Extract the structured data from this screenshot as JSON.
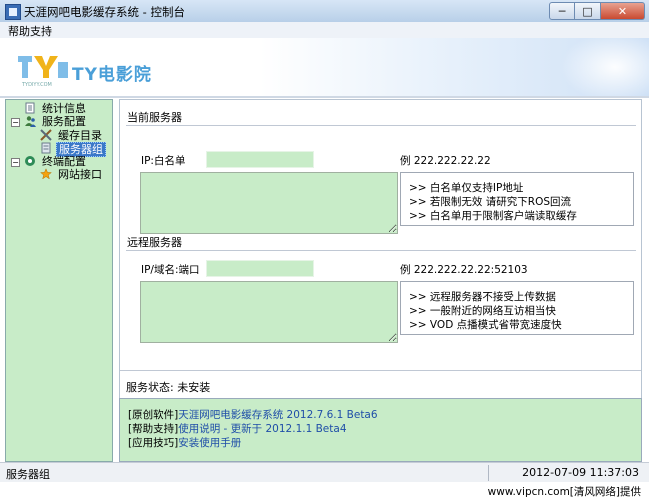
{
  "window": {
    "title": "天涯网吧电影缓存系统 - 控制台",
    "min_glyph": "─",
    "max_glyph": "□",
    "close_glyph": "✕"
  },
  "menu": {
    "help": "帮助支持"
  },
  "banner": {
    "logo_text": "TY电影院",
    "logo_sub": "TYDIYY.COM"
  },
  "tree": {
    "items": [
      {
        "label": "统计信息"
      },
      {
        "label": "服务配置",
        "expander": "−"
      },
      {
        "label": "缓存目录"
      },
      {
        "label": "服务器组"
      },
      {
        "label": "终端配置",
        "expander": "−"
      },
      {
        "label": "网站接口"
      }
    ]
  },
  "current_server": {
    "title": "当前服务器",
    "ip_label": "IP:白名单",
    "ip_value": "",
    "example": "例 222.222.22.22",
    "notes": [
      ">> 白名单仅支持IP地址",
      ">> 若限制无效 请研究下ROS回流",
      ">> 白名单用于限制客户端读取缓存"
    ]
  },
  "remote_server": {
    "title": "远程服务器",
    "ip_label": "IP/域名:端口",
    "ip_value": "",
    "example": "例 222.222.22.22:52103",
    "notes": [
      ">> 远程服务器不接受上传数据",
      ">> 一般附近的网络互访相当快",
      ">> VOD 点播模式省带宽速度快"
    ]
  },
  "service_status": "服务状态: 未安装",
  "log": [
    {
      "key": "[原创软件]",
      "value": "天涯网吧电影缓存系统 2012.7.6.1 Beta6"
    },
    {
      "key": "[帮助支持]",
      "value": "使用说明 - 更新于 2012.1.1 Beta4"
    },
    {
      "key": "[应用技巧]",
      "value": "安装使用手册"
    }
  ],
  "statusbar": {
    "left": "服务器组",
    "right": "2012-07-09 11:37:03"
  },
  "watermark": "www.vipcn.com[清风网络]提供",
  "colors": {
    "panel_green": "#c8ecc8",
    "link_blue": "#1f4ea8",
    "selection_blue": "#3a78c8",
    "logo_blue": "#4a9fd8"
  }
}
